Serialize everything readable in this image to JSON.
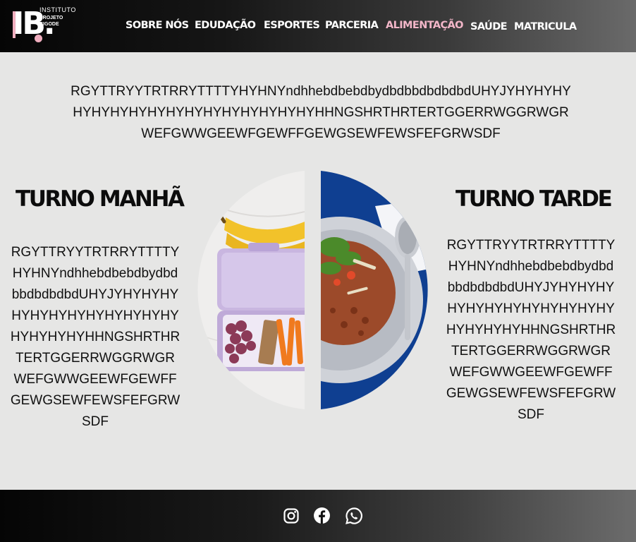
{
  "brand": {
    "mark": "IB.",
    "line1": "INSTITUTO",
    "line2": "PROJETO",
    "line3": "BIGODE",
    "accent_color": "#f2b6c8"
  },
  "nav": {
    "items": [
      {
        "label": "SOBRE NÓS"
      },
      {
        "label": "EDUDAÇÃO"
      },
      {
        "label": "ESPORTES"
      },
      {
        "label": "PARCERIA"
      },
      {
        "label": "ALIMENTAÇÃO",
        "active": true
      },
      {
        "label": "SAÚDE"
      },
      {
        "label": "MATRICULA"
      }
    ]
  },
  "intro": {
    "text": "RGYTTRYYTRTRRYTTTTYHYHNYndhhebdbebdbydbdbbdbdbdbdUHYJYHYHYHYHYHYHYHYHYHYHYHYHYHYHYHYHYHHNGSHRTHRTERTGGERRWGGRWGRWEFGWWGEEWFGEWFFGEWGSEWFEWSFEFGRWSDF"
  },
  "morning": {
    "title": "TURNO MANHÃ",
    "text": "RGYTTRYYTRTRRYTTTTYHYHNYndhhebdbebdbydbdbbdbdbdbdUHYJYHYHYHYHYHYHYHYHYHYHYHYHYHYHYHYHYHHNGSHRTHRTERTGGERRWGGRWGRWEFGWWGEEWFGEWFFGEWGSEWFEWSFEFGRWSDF"
  },
  "afternoon": {
    "title": "TURNO TARDE",
    "text": "RGYTTRYYTRTRRYTTTTYHYHNYndhhebdbebdbydbdbbdbdbdbdUHYJYHYHYHYHYHYHYHYHYHYHYHYHYHYHYHYHYHHNGSHRTHRTERTGGERRWGGRWGRWEFGWWGEEWFGEWFFGEWGSEWFEWSFEFGRWSDF"
  },
  "footer": {
    "icons": [
      "instagram-icon",
      "facebook-icon",
      "whatsapp-icon"
    ]
  },
  "colors": {
    "page_bg": "#e6e6e5",
    "plate_blue": "#0f3f91"
  }
}
